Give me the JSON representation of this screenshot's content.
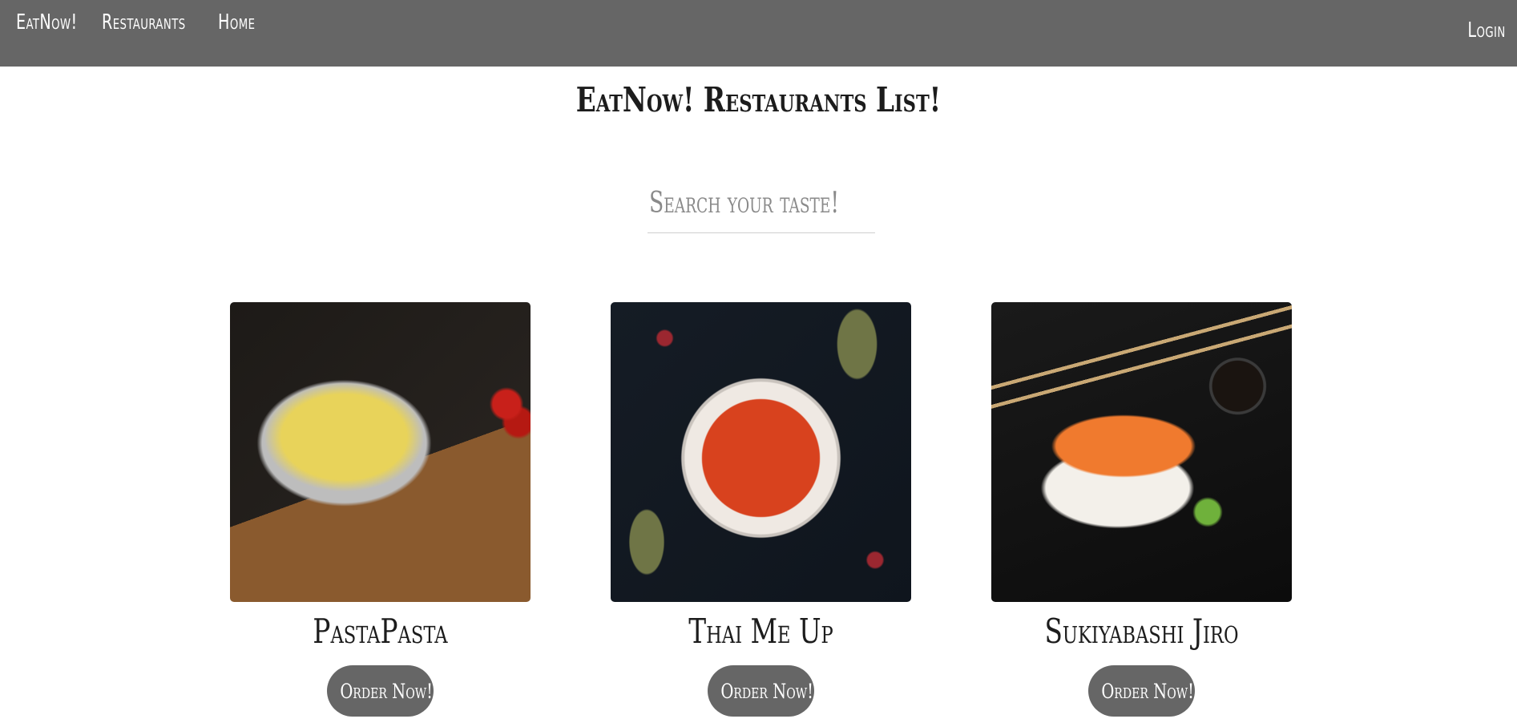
{
  "navbar": {
    "brand": "EatNow!",
    "links": [
      "Restaurants",
      "Home"
    ],
    "login": "Login"
  },
  "page": {
    "title": "EatNow! Restaurants List!"
  },
  "search": {
    "placeholder": "Search your taste!",
    "value": ""
  },
  "restaurants": [
    {
      "name": "PastaPasta",
      "button": "Order Now!",
      "image": "pasta-dish"
    },
    {
      "name": "Thai Me Up",
      "button": "Order Now!",
      "image": "thai-curry-dish"
    },
    {
      "name": "Sukiyabashi Jiro",
      "button": "Order Now!",
      "image": "sushi-dish"
    }
  ],
  "colors": {
    "navbar_bg": "#666666",
    "button_bg": "#666666",
    "text": "#1c1c1c",
    "page_bg": "#ffffff"
  }
}
